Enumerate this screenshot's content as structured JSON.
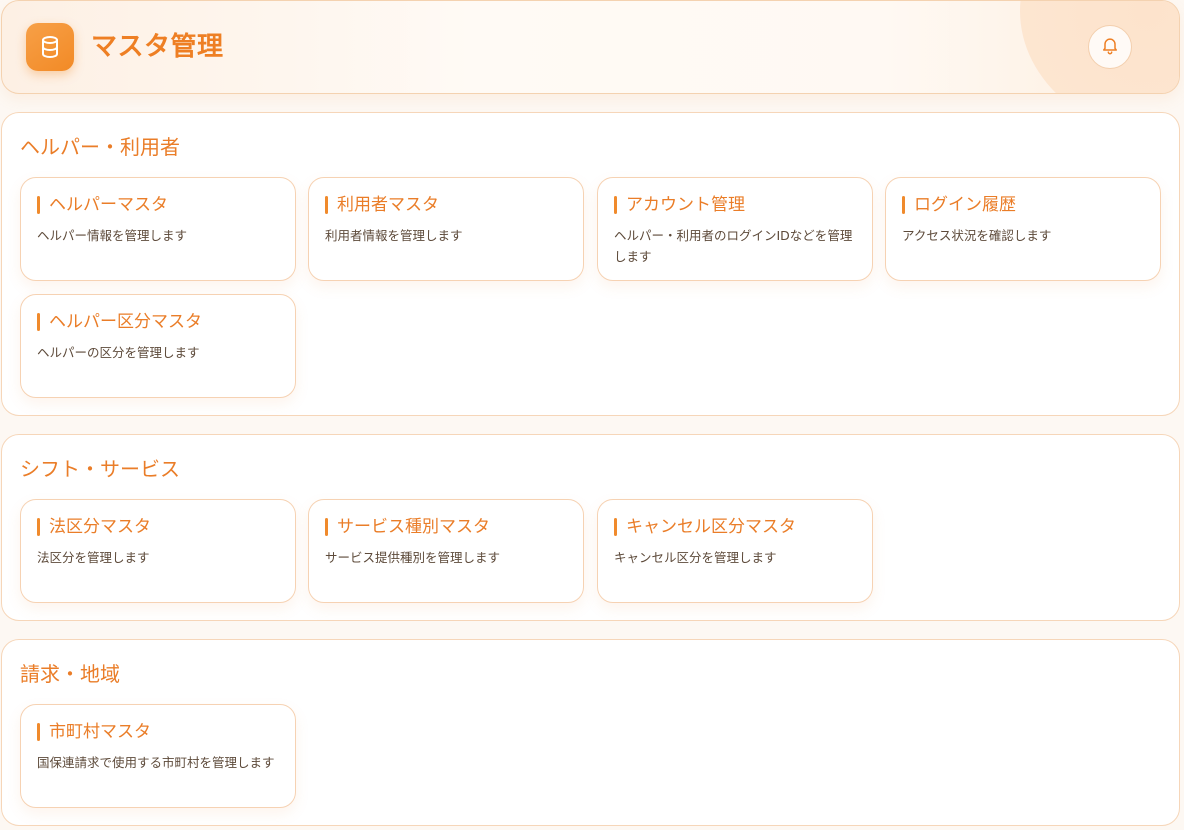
{
  "header": {
    "title": "マスタ管理",
    "app_icon": "database-icon",
    "bell_icon": "bell-icon"
  },
  "colors": {
    "accent": "#ee7f24",
    "card_border": "#f6d2b3",
    "background": "#fdf8f3"
  },
  "sections": [
    {
      "title": "ヘルパー・利用者",
      "cards": [
        {
          "title": "ヘルパーマスタ",
          "desc": "ヘルパー情報を管理します"
        },
        {
          "title": "利用者マスタ",
          "desc": "利用者情報を管理します"
        },
        {
          "title": "アカウント管理",
          "desc": "ヘルパー・利用者のログインIDなどを管理します"
        },
        {
          "title": "ログイン履歴",
          "desc": "アクセス状況を確認します"
        },
        {
          "title": "ヘルパー区分マスタ",
          "desc": "ヘルパーの区分を管理します"
        }
      ]
    },
    {
      "title": "シフト・サービス",
      "cards": [
        {
          "title": "法区分マスタ",
          "desc": "法区分を管理します"
        },
        {
          "title": "サービス種別マスタ",
          "desc": "サービス提供種別を管理します"
        },
        {
          "title": "キャンセル区分マスタ",
          "desc": "キャンセル区分を管理します"
        }
      ]
    },
    {
      "title": "請求・地域",
      "cards": [
        {
          "title": "市町村マスタ",
          "desc": "国保連請求で使用する市町村を管理します"
        }
      ]
    }
  ]
}
